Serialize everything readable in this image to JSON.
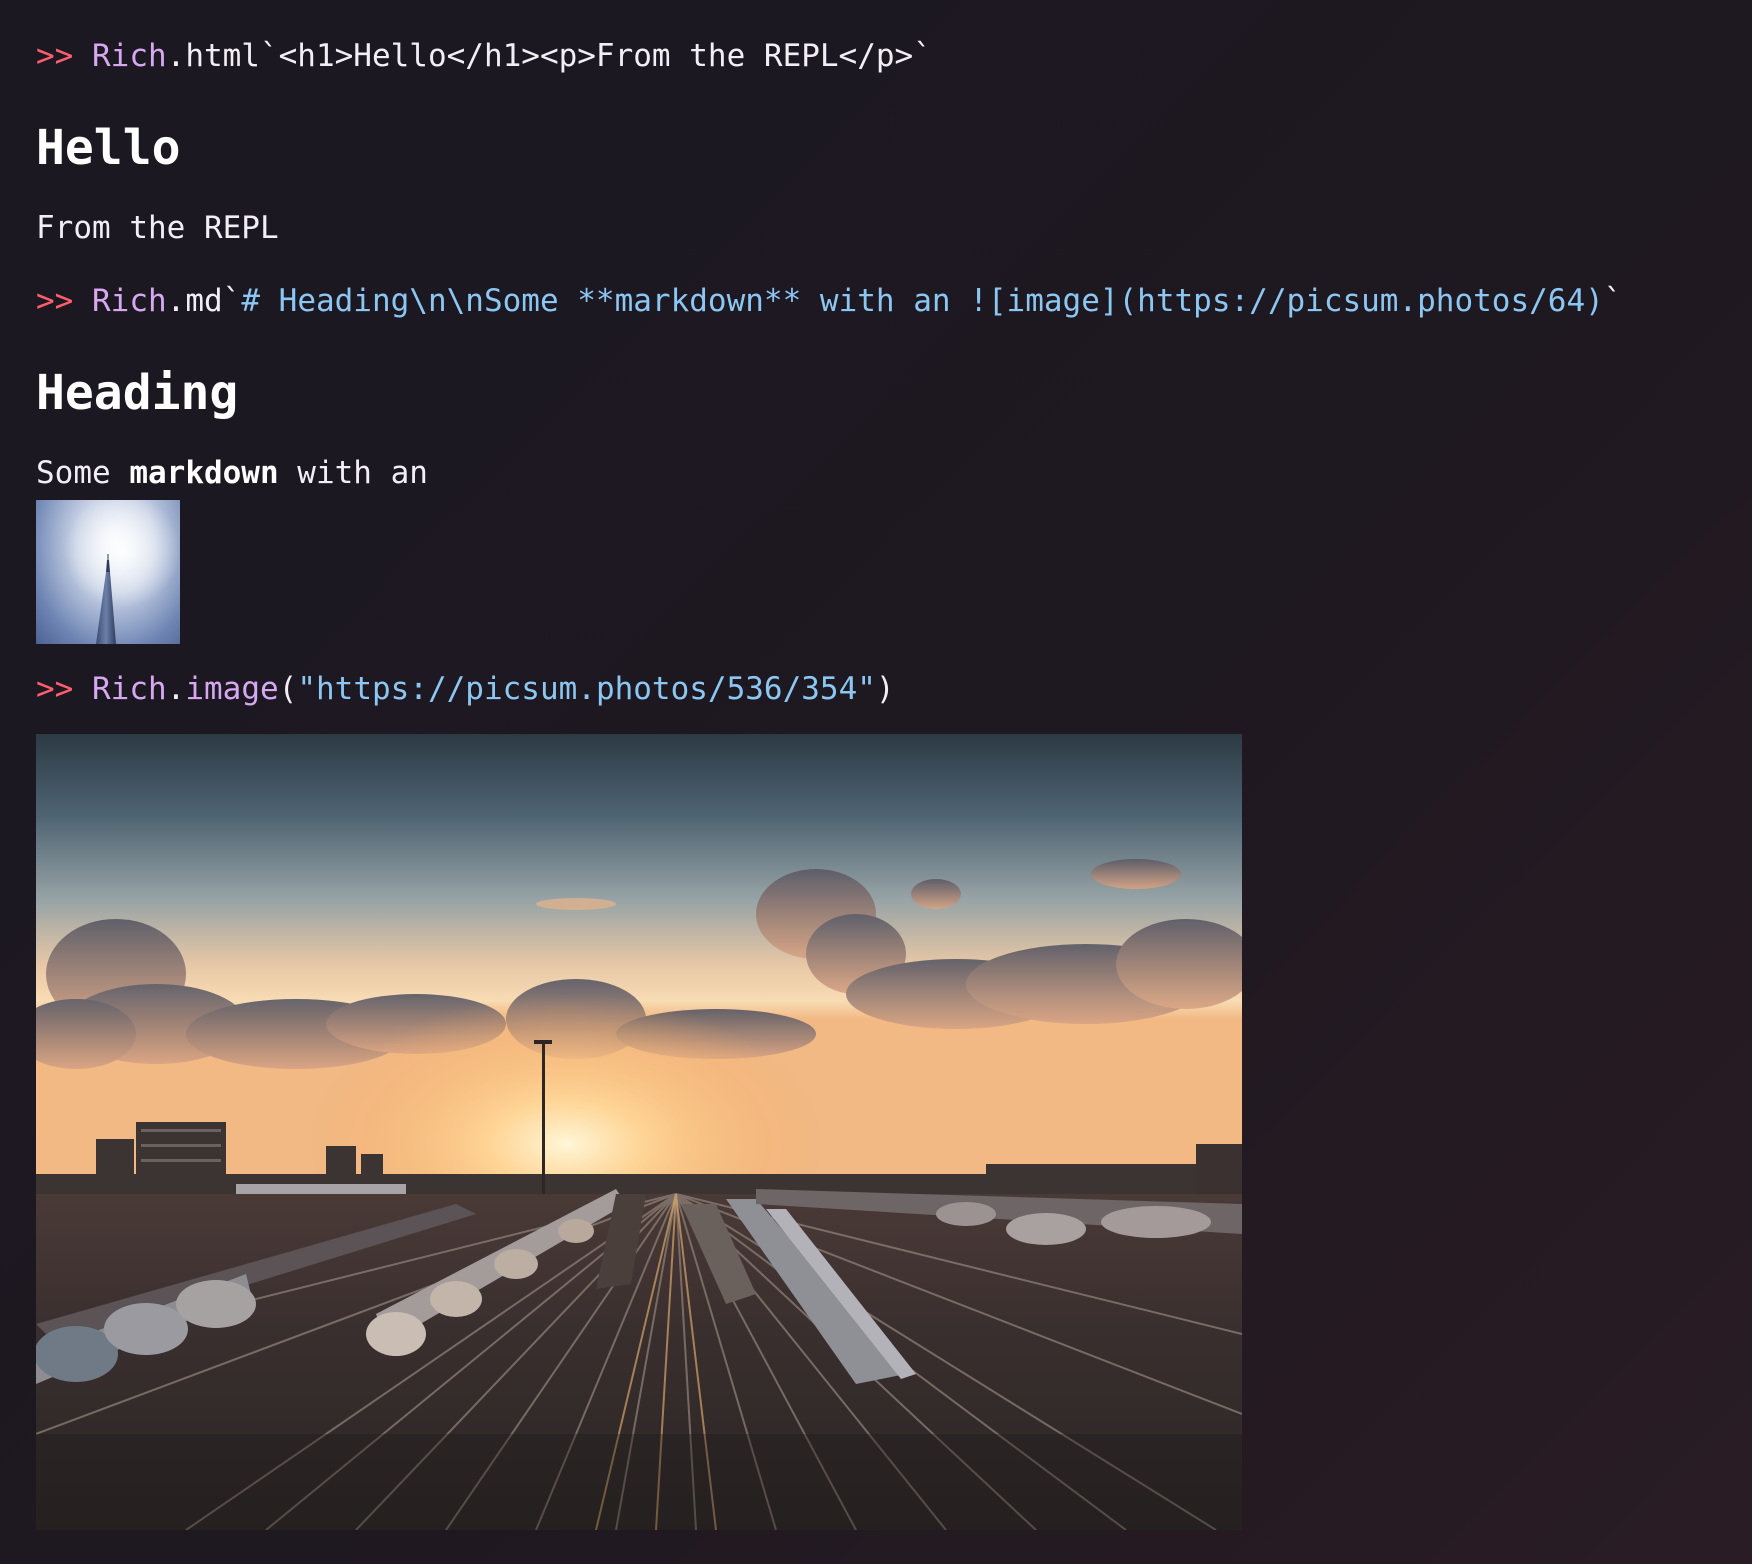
{
  "repl": {
    "cmd1": {
      "prompt": ">>",
      "object": "Rich",
      "method": ".html",
      "template": "`<h1>Hello</h1><p>From the REPL</p>`"
    },
    "out1": {
      "heading": "Hello",
      "paragraph": "From the REPL"
    },
    "cmd2": {
      "prompt": ">>",
      "object": "Rich",
      "method": ".md",
      "tick_open": "`",
      "template": "# Heading\\n\\nSome **markdown** with an ![image](https://picsum.photos/64)",
      "tick_close": "`"
    },
    "out2": {
      "heading": "Heading",
      "text_before": "Some ",
      "bold": "markdown",
      "text_after": " with an"
    },
    "cmd3": {
      "prompt": ">>",
      "object": "Rich",
      "method": ".image",
      "open_paren": "(",
      "argument": "\"https://picsum.photos/536/354\"",
      "close_paren": ")"
    }
  },
  "colors": {
    "background": "#1c1922",
    "prompt": "#ff5f6d",
    "object": "#d7a8f0",
    "string": "#8cc6f2",
    "text": "#f2eef4"
  },
  "icons": {
    "md_image": "tower-photo",
    "rich_image": "railway-sunset-photo"
  }
}
